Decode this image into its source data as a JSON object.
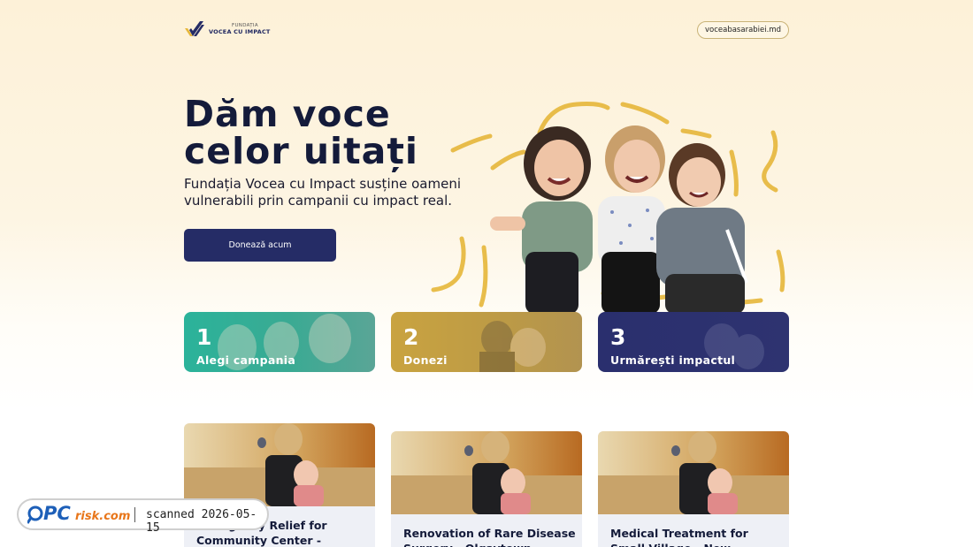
{
  "header": {
    "logo_small": "FUNDAȚIA",
    "logo_big": "VOCEA CU IMPACT",
    "site_link": "voceabasarabiei.md"
  },
  "hero": {
    "title": "Dăm voce\ncelor uitați",
    "subtitle": "Fundația Vocea cu Impact susține oameni vulnerabili prin campanii cu impact real.",
    "cta_label": "Donează acum",
    "image_icon": "children-photo"
  },
  "steps": [
    {
      "number": "1",
      "label": "Alegi campania",
      "color": "#2bb39a"
    },
    {
      "number": "2",
      "label": "Donezi",
      "color": "#c9a340"
    },
    {
      "number": "3",
      "label": "Urmărești impactul",
      "color": "#2a2f6e"
    }
  ],
  "campaigns": [
    {
      "title": "Emergency Relief for Community Center -"
    },
    {
      "title": "Renovation of Rare Disease Surgery - Olgaytown"
    },
    {
      "title": "Medical Treatment for Small Village - New Izabmouth"
    }
  ],
  "watermark": {
    "logo_pc": "PC",
    "logo_risk": "risk.com",
    "text": "scanned 2026-05-15"
  },
  "colors": {
    "accent": "#252c66",
    "brand_gold": "#e6b73a",
    "teal": "#2bb39a",
    "gold": "#c9a340",
    "navy": "#2a2f6e"
  }
}
